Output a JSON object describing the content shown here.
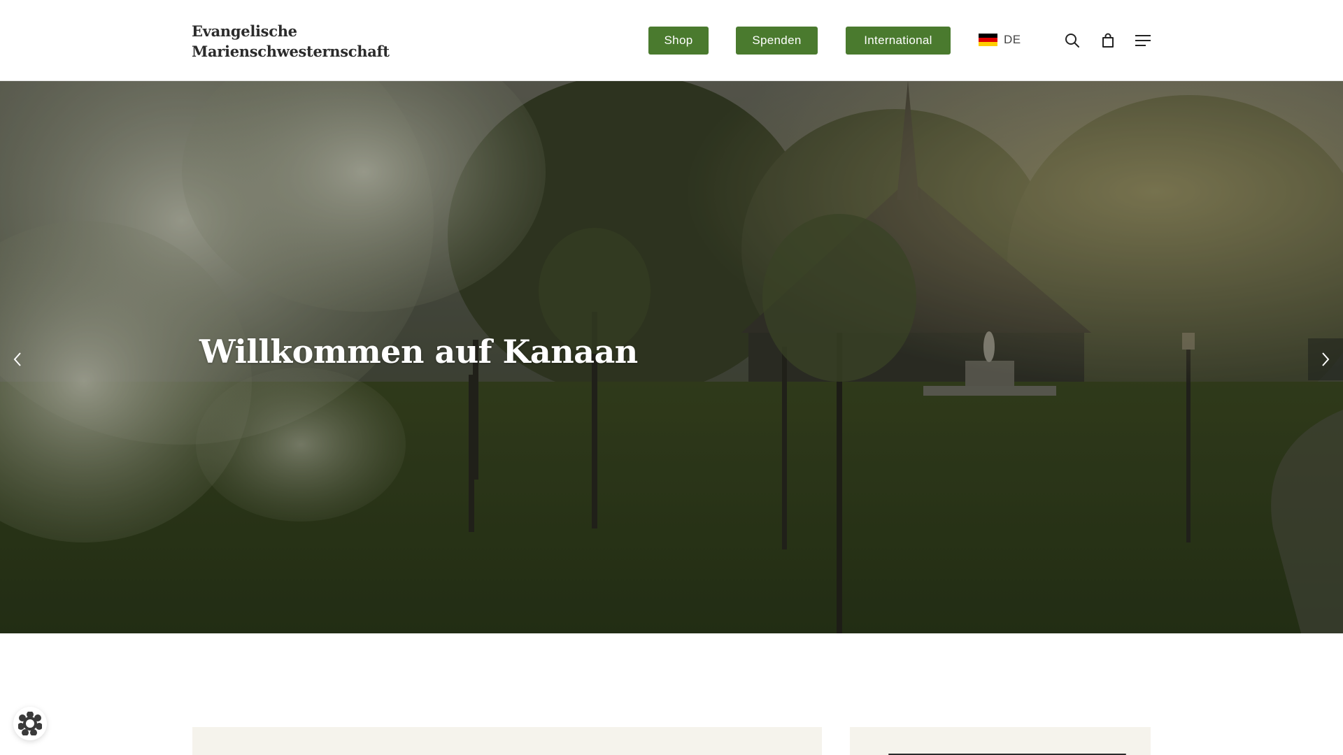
{
  "header": {
    "logo_line1": "Evangelische",
    "logo_line2": "Marienschwesternschaft",
    "nav": {
      "shop": "Shop",
      "spenden": "Spenden",
      "international": "International"
    },
    "language": {
      "code": "DE",
      "flag_icon": "germany-flag-icon"
    },
    "icons": [
      "search-icon",
      "shopping-bag-icon",
      "menu-icon"
    ],
    "accent_color": "#4a7a2e"
  },
  "hero": {
    "title": "Willkommen auf Kanaan",
    "prev_icon": "chevron-left-icon",
    "next_icon": "chevron-right-icon"
  },
  "floating_widget": {
    "icon": "flower-cookie-icon"
  }
}
